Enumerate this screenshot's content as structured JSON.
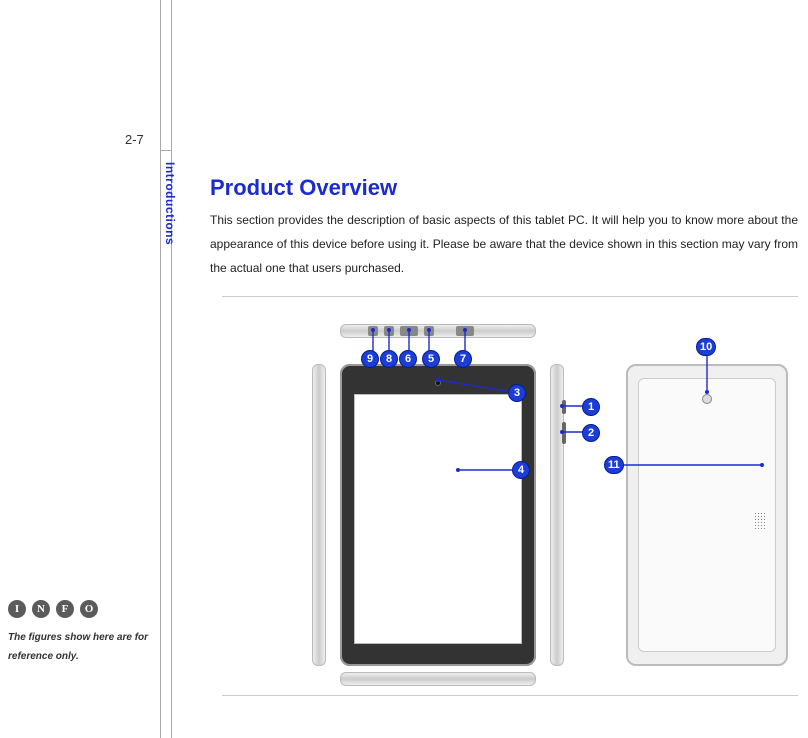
{
  "page_number": "2-7",
  "section_label": "Introductions",
  "heading": "Product Overview",
  "body": "This section provides the description of basic aspects of this tablet PC. It will help you to know more about the appearance of this device before using it. Please be aware that the device shown in this section may vary from the actual one that users purchased.",
  "callouts": {
    "c1": "1",
    "c2": "2",
    "c3": "3",
    "c4": "4",
    "c5": "5",
    "c6": "6",
    "c7": "7",
    "c8": "8",
    "c9": "9",
    "c10": "10",
    "c11": "11"
  },
  "info": {
    "glyph_i": "I",
    "glyph_n": "N",
    "glyph_f": "F",
    "glyph_o": "O",
    "text": "The figures show here are for reference only."
  }
}
